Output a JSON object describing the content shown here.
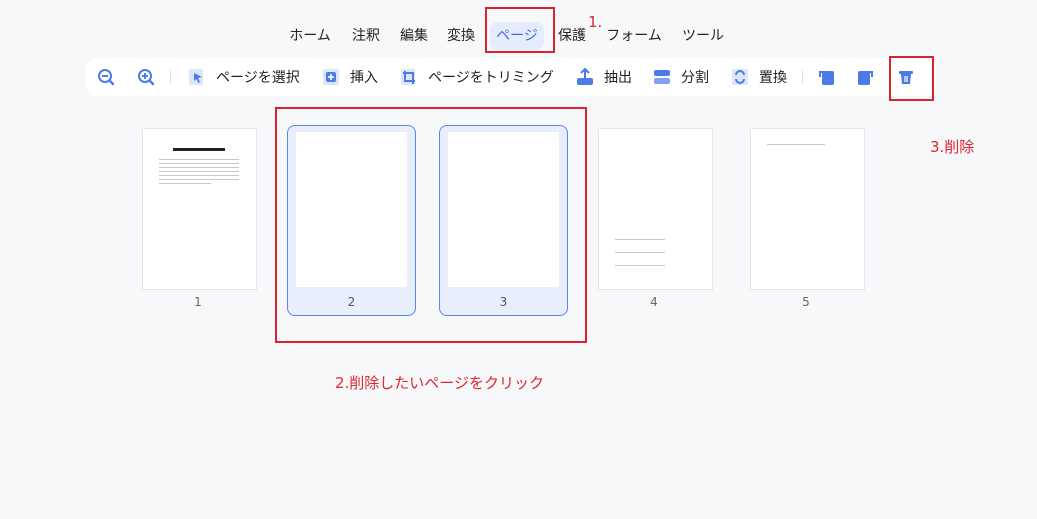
{
  "menu": {
    "tabs": [
      {
        "label": "ホーム"
      },
      {
        "label": "注釈"
      },
      {
        "label": "編集"
      },
      {
        "label": "変換"
      },
      {
        "label": "ページ",
        "active": true
      },
      {
        "label": "保護"
      },
      {
        "label": "フォーム"
      },
      {
        "label": "ツール"
      }
    ]
  },
  "toolbar": {
    "zoom_out_icon": "zoom-out-icon",
    "zoom_in_icon": "zoom-in-icon",
    "select_pages": "ページを選択",
    "insert": "挿入",
    "trim_pages": "ページをトリミング",
    "extract": "抽出",
    "split": "分割",
    "replace": "置換",
    "rotate_left_icon": "rotate-left-icon",
    "rotate_right_icon": "rotate-right-icon",
    "delete_icon": "trash-icon"
  },
  "pages": [
    {
      "number": "1",
      "selected": false
    },
    {
      "number": "2",
      "selected": true
    },
    {
      "number": "3",
      "selected": true
    },
    {
      "number": "4",
      "selected": false
    },
    {
      "number": "5",
      "selected": false
    }
  ],
  "annotations": {
    "step1": "1.",
    "step2": "2.削除したいページをクリック",
    "step3": "3.削除"
  },
  "colors": {
    "accent": "#3b6fe8",
    "selection_bg": "#e8eefc",
    "annotation_red": "#d9232d",
    "icon_blue": "#4a7be6"
  }
}
